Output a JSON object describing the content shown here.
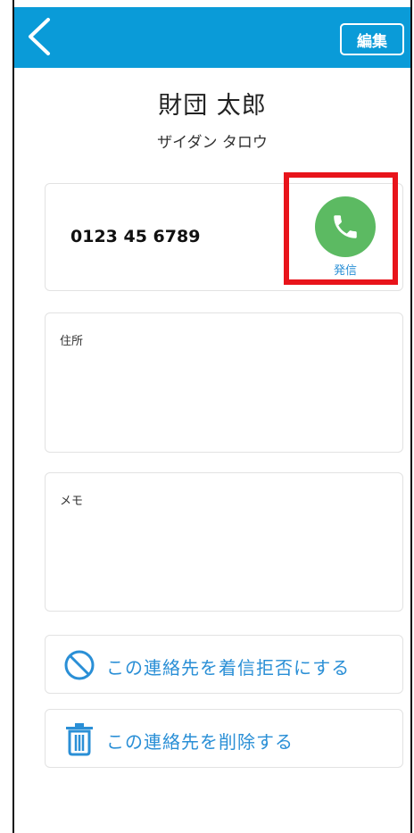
{
  "header": {
    "back_icon": "chevron-left-icon",
    "edit_label": "編集"
  },
  "contact": {
    "name": "財団 太郎",
    "kana": "ザイダン タロウ",
    "phone": "0123 45 6789",
    "call_label": "発信",
    "call_icon": "phone-icon"
  },
  "fields": {
    "address_label": "住所",
    "address_value": "",
    "memo_label": "メモ",
    "memo_value": ""
  },
  "actions": {
    "block_label": "この連絡先を着信拒否にする",
    "block_icon": "prohibited-icon",
    "delete_label": "この連絡先を削除する",
    "delete_icon": "trash-icon"
  },
  "colors": {
    "header": "#0a9bd8",
    "call_button": "#5cba62",
    "accent_text": "#2a8fd6",
    "highlight": "#e8141b"
  }
}
